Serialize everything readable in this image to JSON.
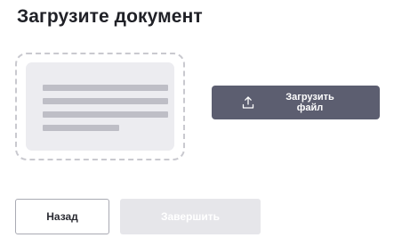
{
  "page": {
    "title": "Загрузите документ"
  },
  "dropzone": {
    "icon": "document-placeholder-icon"
  },
  "upload_button": {
    "label": "Загрузить файл",
    "icon": "upload-icon",
    "background_color": "#5c5e70"
  },
  "footer": {
    "back_label": "Назад",
    "finish_label": "Завершить",
    "finish_state": "disabled"
  }
}
